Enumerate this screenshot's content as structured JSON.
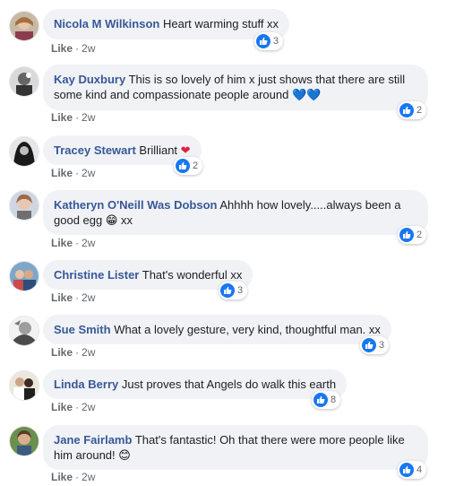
{
  "like_label": "Like",
  "time_label": "2w",
  "comments": [
    {
      "author": "Nicola M Wilkinson",
      "text": "Heart warming stuff xx",
      "reactions": "3"
    },
    {
      "author": "Kay Duxbury",
      "text": "This is so lovely of him x just shows that there are still some kind and compassionate people around",
      "emoji": "💙💙",
      "reactions": "2"
    },
    {
      "author": "Tracey Stewart",
      "text": "Brilliant",
      "emoji": "❤",
      "reactions": "2"
    },
    {
      "author": "Katheryn O'Neill Was Dobson",
      "text": "Ahhhh how lovely.....always been a good egg",
      "emoji": "😁",
      "text2": "xx",
      "reactions": "2"
    },
    {
      "author": "Christine Lister",
      "text": "That's wonderful xx",
      "reactions": "3"
    },
    {
      "author": "Sue Smith",
      "text": "What a lovely gesture, very kind, thoughtful man. xx",
      "reactions": "3"
    },
    {
      "author": "Linda Berry",
      "text": "Just proves that Angels do walk this earth",
      "reactions": "8"
    },
    {
      "author": "Jane Fairlamb",
      "text": "That's fantastic! Oh that there were more people like him around!",
      "emoji": "😊",
      "reactions": "4"
    }
  ]
}
